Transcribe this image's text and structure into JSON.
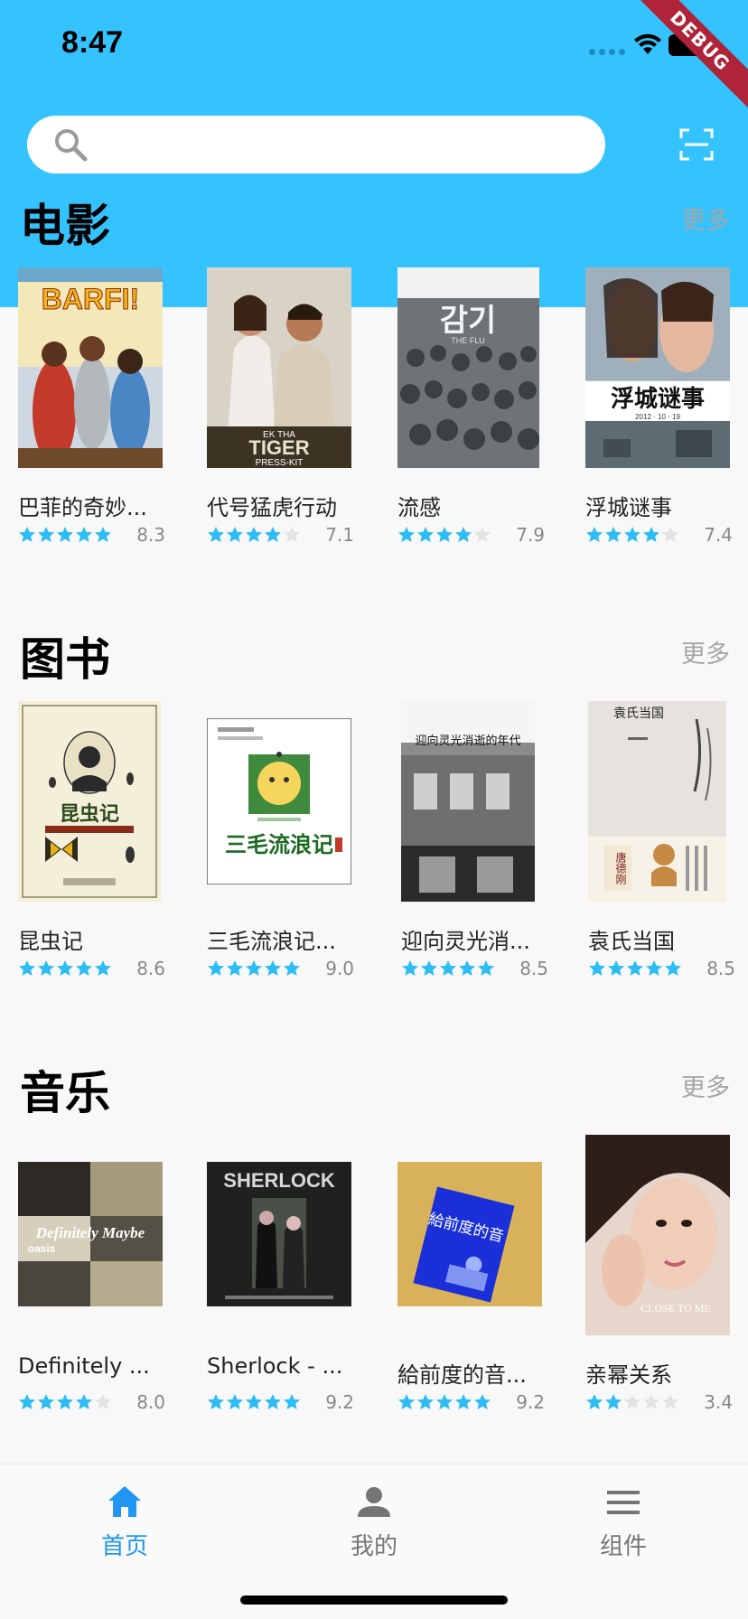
{
  "status_bar": {
    "time": "8:47",
    "debug_label": "DEBUG"
  },
  "search": {
    "placeholder": ""
  },
  "sections": [
    {
      "title": "电影",
      "more": "更多",
      "items": [
        {
          "title": "巴菲的奇妙...",
          "rating": "8.3",
          "stars": 5
        },
        {
          "title": "代号猛虎行动",
          "rating": "7.1",
          "stars": 4
        },
        {
          "title": "流感",
          "rating": "7.9",
          "stars": 4
        },
        {
          "title": "浮城谜事",
          "rating": "7.4",
          "stars": 4
        }
      ]
    },
    {
      "title": "图书",
      "more": "更多",
      "items": [
        {
          "title": "昆虫记",
          "rating": "8.6",
          "stars": 5
        },
        {
          "title": "三毛流浪记...",
          "rating": "9.0",
          "stars": 5
        },
        {
          "title": "迎向灵光消...",
          "rating": "8.5",
          "stars": 5
        },
        {
          "title": "袁氏当国",
          "rating": "8.5",
          "stars": 5
        }
      ]
    },
    {
      "title": "音乐",
      "more": "更多",
      "items": [
        {
          "title": "Definitely ...",
          "rating": "8.0",
          "stars": 4
        },
        {
          "title": "Sherlock - ...",
          "rating": "9.2",
          "stars": 5
        },
        {
          "title": "給前度的音...",
          "rating": "9.2",
          "stars": 5
        },
        {
          "title": "亲幂关系",
          "rating": "3.4",
          "stars": 2
        }
      ]
    }
  ],
  "posters": {
    "barfi": {
      "logo": "BARFI!"
    },
    "tiger": {
      "line1": "EK THA",
      "line2": "TIGER",
      "line3": "PRESS-KIT"
    },
    "flu": {
      "title": "감기",
      "sub": "THE FLU"
    },
    "fucheng": {
      "title": "浮城谜事",
      "date": "2012 · 10 · 19"
    },
    "insect": {
      "title": "昆虫记"
    },
    "sanmao": {
      "title": "三毛流浪记"
    },
    "aura": {
      "title": "迎向灵光消逝的年代"
    },
    "yuan": {
      "title": "袁氏当国",
      "author": "唐德刚"
    },
    "oasis": {
      "title": "Definitely Maybe",
      "band": "oasis"
    },
    "sherlock": {
      "title": "SHERLOCK"
    },
    "ex": {
      "title": "給前度的音"
    },
    "close": {
      "title": "CLOSE TO ME"
    }
  },
  "bottom_nav": [
    {
      "label": "首页",
      "active": true
    },
    {
      "label": "我的",
      "active": false
    },
    {
      "label": "组件",
      "active": false
    }
  ],
  "colors": {
    "header_bg": "#35c3ff",
    "star_on": "#2ebcf5",
    "star_off": "#e3e3e3",
    "nav_active": "#2196f3",
    "nav_inactive": "#757575"
  }
}
